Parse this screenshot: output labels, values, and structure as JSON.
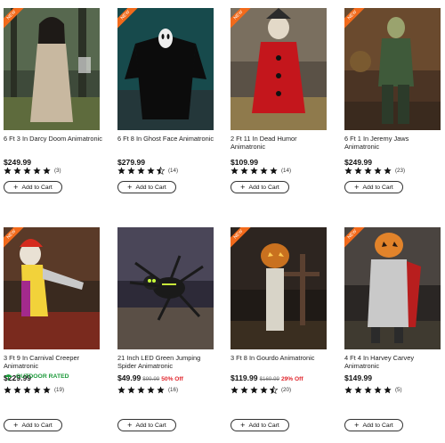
{
  "products": [
    {
      "title": "6 Ft 3 In Darcy Doom Animatronic",
      "price": "$249.99",
      "was": "",
      "off": "",
      "rating": 5,
      "reviews": "(3)",
      "outdoor": "",
      "badge": "NEW",
      "cart_label": "Add to Cart",
      "image": "figure-darcy-doom"
    },
    {
      "title": "6 Ft 8 In Ghost Face Animatronic",
      "price": "$279.99",
      "was": "",
      "off": "",
      "rating": 4.5,
      "reviews": "(14)",
      "outdoor": "",
      "badge": "NEW",
      "cart_label": "Add to Cart",
      "image": "figure-ghost-face"
    },
    {
      "title": "2 Ft 11 In Dead Humor Animatronic",
      "price": "$109.99",
      "was": "",
      "off": "",
      "rating": 5,
      "reviews": "(14)",
      "outdoor": "",
      "badge": "NEW",
      "cart_label": "Add to Cart",
      "image": "figure-dead-humor"
    },
    {
      "title": "6 Ft 1 In Jeremy Jaws Animatronic",
      "price": "$249.99",
      "was": "",
      "off": "",
      "rating": 5,
      "reviews": "(23)",
      "outdoor": "",
      "badge": "NEW",
      "cart_label": "Add to Cart",
      "image": "figure-jeremy-jaws"
    },
    {
      "title": "3 Ft 9 In Carnival Creeper Animatronic",
      "price": "$229.99",
      "was": "",
      "off": "",
      "rating": 5,
      "reviews": "(19)",
      "outdoor": "OUTDOOR RATED",
      "badge": "NEW",
      "cart_label": "Add to Cart",
      "image": "figure-carnival-creeper"
    },
    {
      "title": "21 Inch LED Green Jumping Spider Animatronic",
      "price": "$49.99",
      "was": "$99.99",
      "off": "50% Off",
      "rating": 5,
      "reviews": "(16)",
      "outdoor": "",
      "badge": "",
      "cart_label": "Add to Cart",
      "image": "figure-jumping-spider"
    },
    {
      "title": "3 Ft 8 In Gourdo Animatronic",
      "price": "$119.99",
      "was": "$169.99",
      "off": "29% Off",
      "rating": 4.5,
      "reviews": "(20)",
      "outdoor": "",
      "badge": "NEW",
      "cart_label": "Add to Cart",
      "image": "figure-gourdo"
    },
    {
      "title": "4 Ft 4 In Harvey Carvey Animatronic",
      "price": "$149.99",
      "was": "",
      "off": "",
      "rating": 5,
      "reviews": "(5)",
      "outdoor": "",
      "badge": "NEW",
      "cart_label": "Add to Cart",
      "image": "figure-harvey-carvey"
    }
  ],
  "colors": {
    "star": "#111111",
    "sale": "#e0262d",
    "outdoor": "#1c9a3a",
    "badge": "#f26a1b"
  }
}
